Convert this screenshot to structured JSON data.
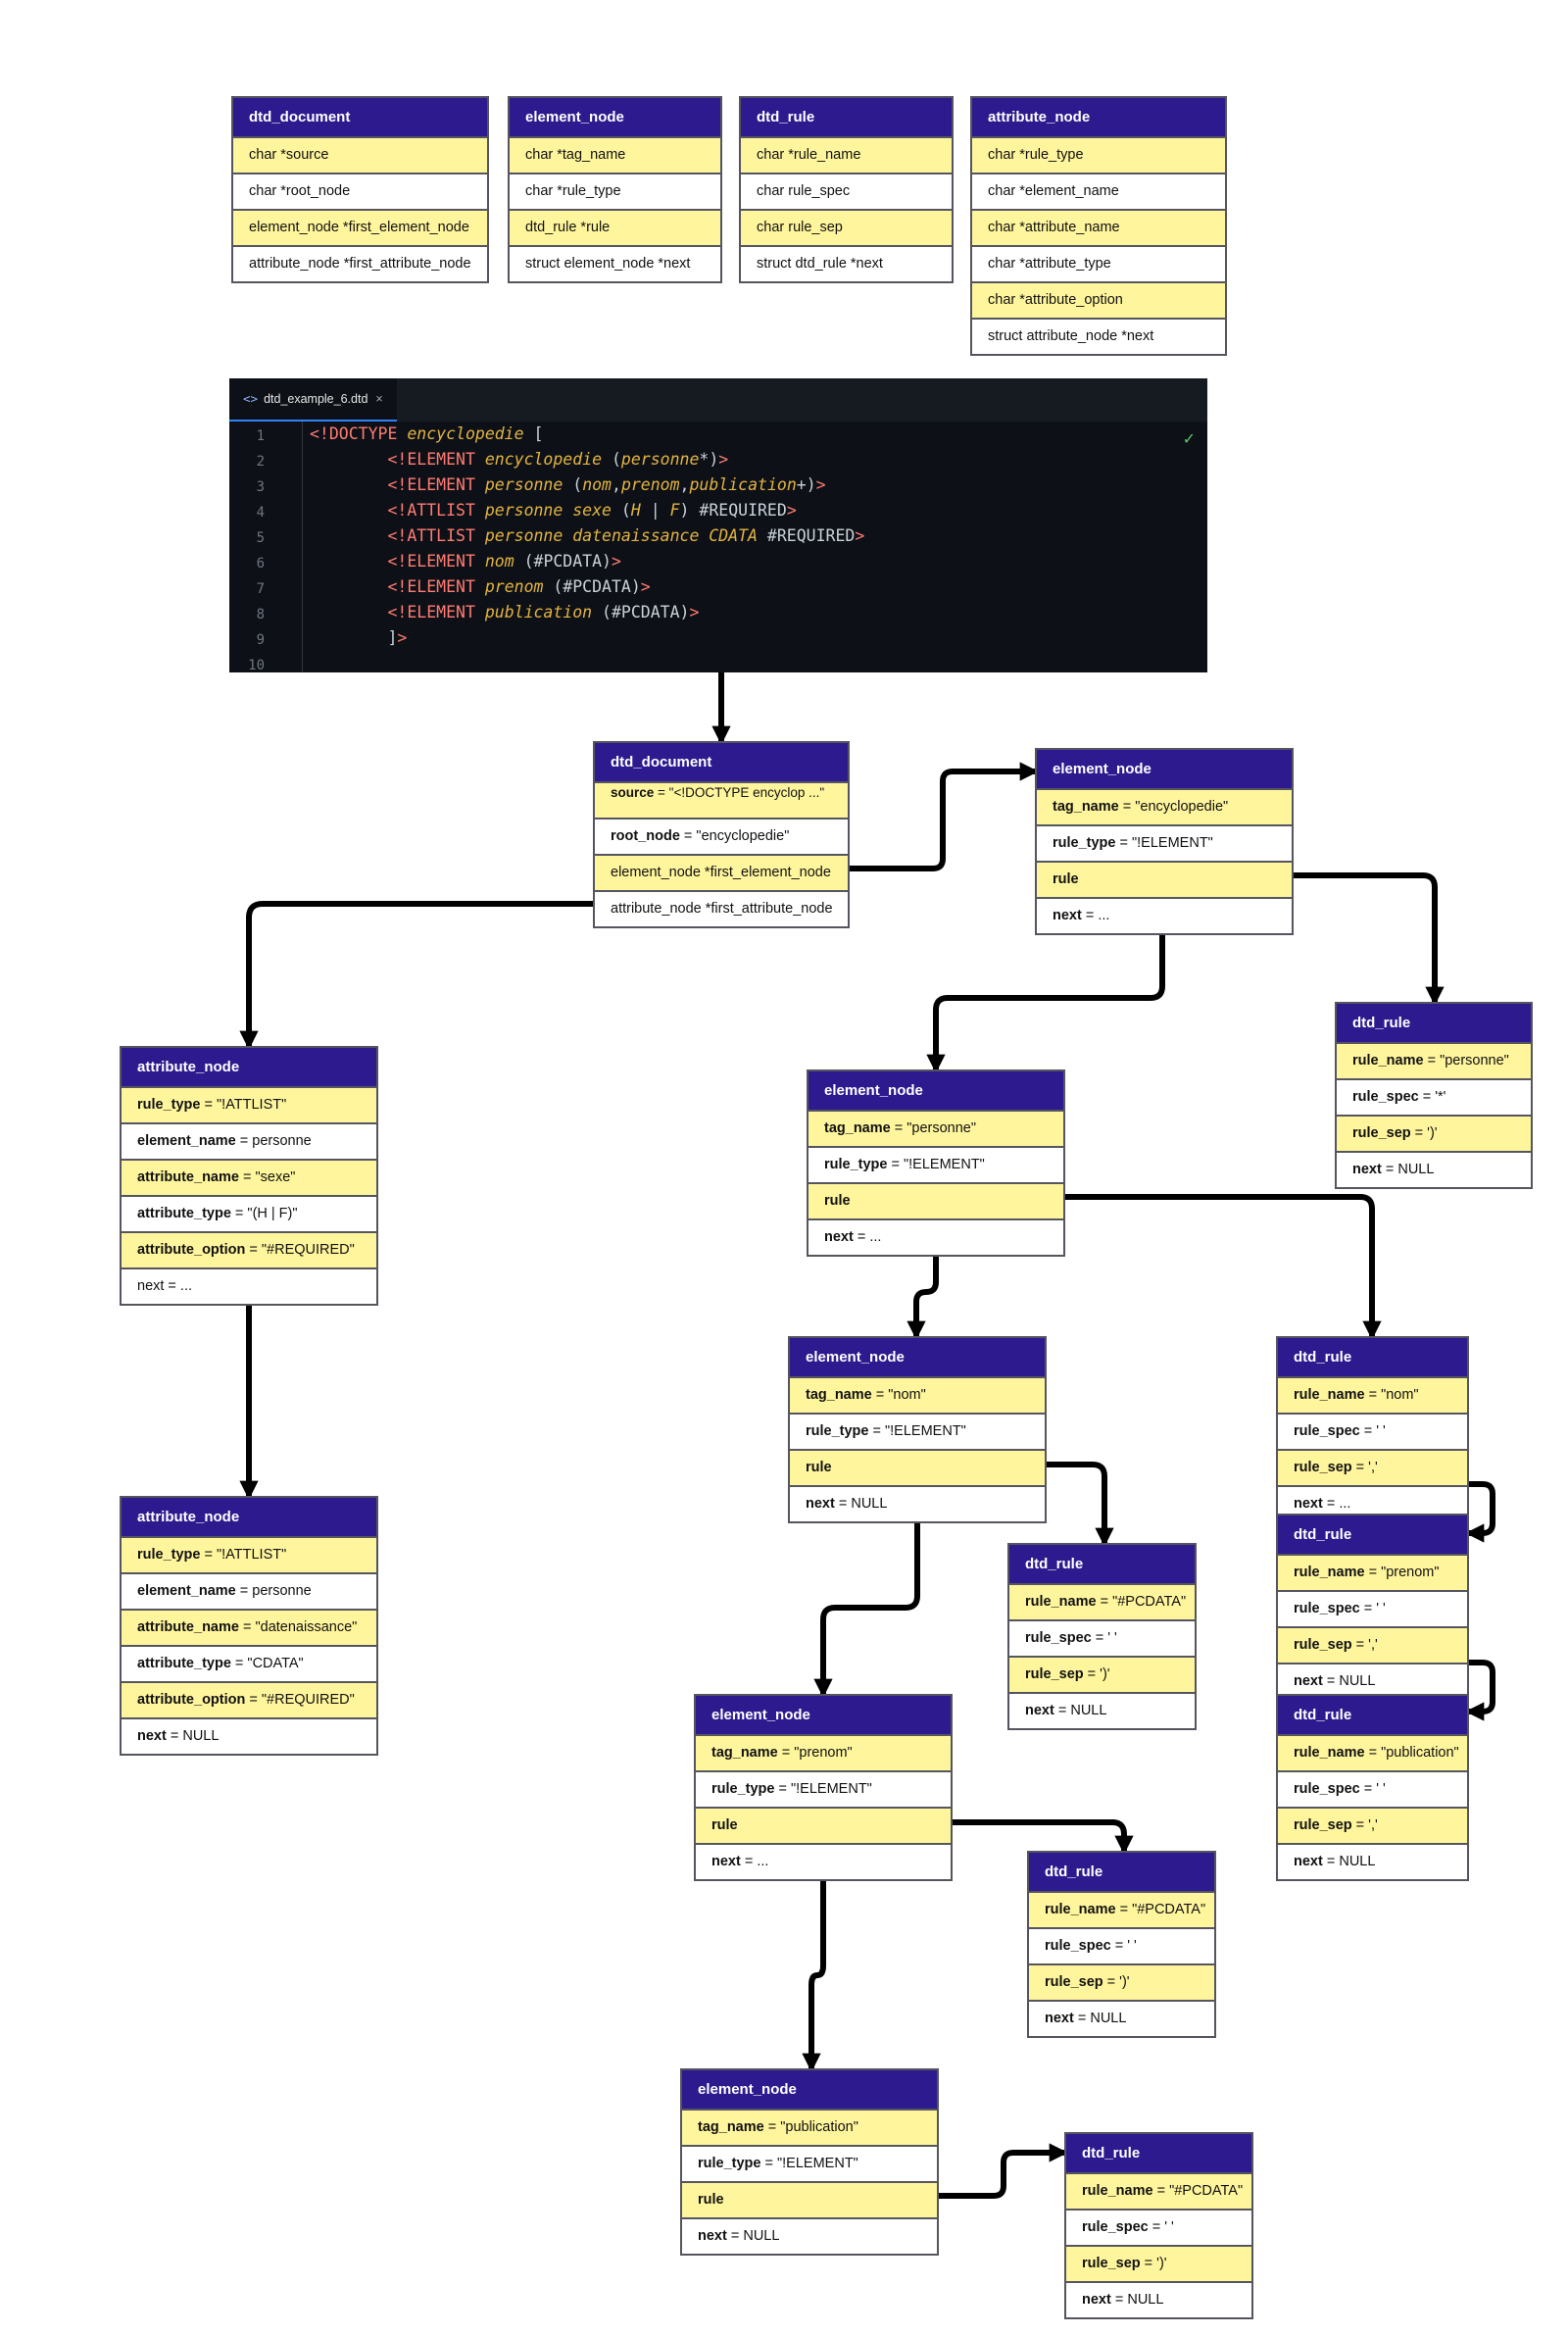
{
  "legend": [
    {
      "title": "dtd_document",
      "rows": [
        "char *source",
        "char *root_node",
        "element_node *first_element_node",
        "attribute_node *first_attribute_node"
      ]
    },
    {
      "title": "element_node",
      "rows": [
        "char *tag_name",
        "char *rule_type",
        "dtd_rule *rule",
        "struct element_node *next"
      ]
    },
    {
      "title": "dtd_rule",
      "rows": [
        "char *rule_name",
        "char rule_spec",
        "char rule_sep",
        "struct dtd_rule *next"
      ]
    },
    {
      "title": "attribute_node",
      "rows": [
        "char *rule_type",
        "char *element_name",
        "char *attribute_name",
        "char *attribute_type",
        "char *attribute_option",
        "struct attribute_node *next"
      ]
    }
  ],
  "editor": {
    "tab_label": "dtd_example_6.dtd",
    "tab_close": "×",
    "tab_icon": "<>",
    "check": "✓",
    "line_numbers": [
      "1",
      "2",
      "3",
      "4",
      "5",
      "6",
      "7",
      "8",
      "9",
      "10"
    ],
    "lines": [
      [
        [
          "kw",
          "<!DOCTYPE "
        ],
        [
          "nm",
          "encyclopedie"
        ],
        [
          "pl",
          " ["
        ]
      ],
      [
        [
          "pl",
          "        "
        ],
        [
          "kw",
          "<!ELEMENT "
        ],
        [
          "nm",
          "encyclopedie"
        ],
        [
          "pl",
          " ("
        ],
        [
          "nm",
          "personne"
        ],
        [
          "pl",
          "*)"
        ],
        [
          "kw",
          ">"
        ]
      ],
      [
        [
          "pl",
          "        "
        ],
        [
          "kw",
          "<!ELEMENT "
        ],
        [
          "nm",
          "personne"
        ],
        [
          "pl",
          " ("
        ],
        [
          "nm",
          "nom"
        ],
        [
          "pl",
          ","
        ],
        [
          "nm",
          "prenom"
        ],
        [
          "pl",
          ","
        ],
        [
          "nm",
          "publication"
        ],
        [
          "pl",
          "+)"
        ],
        [
          "kw",
          ">"
        ]
      ],
      [
        [
          "pl",
          "        "
        ],
        [
          "kw",
          "<!ATTLIST "
        ],
        [
          "nm",
          "personne sexe"
        ],
        [
          "pl",
          " ("
        ],
        [
          "nm",
          "H"
        ],
        [
          "pl",
          " | "
        ],
        [
          "nm",
          "F"
        ],
        [
          "pl",
          ") #REQUIRED"
        ],
        [
          "kw",
          ">"
        ]
      ],
      [
        [
          "pl",
          "        "
        ],
        [
          "kw",
          "<!ATTLIST "
        ],
        [
          "nm",
          "personne datenaissance CDATA"
        ],
        [
          "pl",
          " #REQUIRED"
        ],
        [
          "kw",
          ">"
        ]
      ],
      [
        [
          "pl",
          "        "
        ],
        [
          "kw",
          "<!ELEMENT "
        ],
        [
          "nm",
          "nom"
        ],
        [
          "pl",
          " (#PCDATA)"
        ],
        [
          "kw",
          ">"
        ]
      ],
      [
        [
          "pl",
          "        "
        ],
        [
          "kw",
          "<!ELEMENT "
        ],
        [
          "nm",
          "prenom"
        ],
        [
          "pl",
          " (#PCDATA)"
        ],
        [
          "kw",
          ">"
        ]
      ],
      [
        [
          "pl",
          "        "
        ],
        [
          "kw",
          "<!ELEMENT "
        ],
        [
          "nm",
          "publication"
        ],
        [
          "pl",
          " (#PCDATA)"
        ],
        [
          "kw",
          ">"
        ]
      ],
      [
        [
          "pl",
          "        ]"
        ],
        [
          "kw",
          ">"
        ]
      ],
      [
        [
          "pl",
          ""
        ]
      ]
    ]
  },
  "nodes": {
    "doc": {
      "title": "dtd_document",
      "rows": [
        {
          "k": "source",
          "v": " = \"<!DOCTYPE encyclop ...\""
        },
        {
          "k": "root_node",
          "v": " = \"encyclopedie\""
        },
        {
          "k": "",
          "v": "element_node *first_element_node"
        },
        {
          "k": "",
          "v": "attribute_node *first_attribute_node"
        }
      ]
    },
    "el_ency": {
      "title": "element_node",
      "rows": [
        {
          "k": "tag_name",
          "v": " = \"encyclopedie\""
        },
        {
          "k": "rule_type",
          "v": " = \"!ELEMENT\""
        },
        {
          "k": "rule",
          "v": ""
        },
        {
          "k": "next",
          "v": " = ..."
        }
      ]
    },
    "rule_pers": {
      "title": "dtd_rule",
      "rows": [
        {
          "k": "rule_name",
          "v": " = \"personne\""
        },
        {
          "k": "rule_spec",
          "v": " = '*'"
        },
        {
          "k": "rule_sep",
          "v": " = ')'"
        },
        {
          "k": "next",
          "v": " =  NULL"
        }
      ]
    },
    "el_pers": {
      "title": "element_node",
      "rows": [
        {
          "k": "tag_name",
          "v": " = \"personne\""
        },
        {
          "k": "rule_type",
          "v": " = \"!ELEMENT\""
        },
        {
          "k": "rule",
          "v": ""
        },
        {
          "k": "next",
          "v": " = ..."
        }
      ]
    },
    "attr_sexe": {
      "title": "attribute_node",
      "rows": [
        {
          "k": "rule_type",
          "v": " = \"!ATTLIST\""
        },
        {
          "k": "element_name",
          "v": " = personne"
        },
        {
          "k": "attribute_name",
          "v": " = \"sexe\""
        },
        {
          "k": "attribute_type",
          "v": " = \"(H | F)\""
        },
        {
          "k": "attribute_option",
          "v": " = \"#REQUIRED\""
        },
        {
          "k": "",
          "v": "next = ..."
        }
      ]
    },
    "attr_date": {
      "title": "attribute_node",
      "rows": [
        {
          "k": "rule_type",
          "v": " = \"!ATTLIST\""
        },
        {
          "k": "element_name",
          "v": " = personne"
        },
        {
          "k": "attribute_name",
          "v": " = \"datenaissance\""
        },
        {
          "k": "attribute_type",
          "v": " = \"CDATA\""
        },
        {
          "k": "attribute_option",
          "v": " = \"#REQUIRED\""
        },
        {
          "k": "next",
          "v": " = NULL"
        }
      ]
    },
    "el_nom": {
      "title": "element_node",
      "rows": [
        {
          "k": "tag_name",
          "v": " = \"nom\""
        },
        {
          "k": "rule_type",
          "v": " = \"!ELEMENT\""
        },
        {
          "k": "rule",
          "v": ""
        },
        {
          "k": "next",
          "v": " = NULL"
        }
      ]
    },
    "rule_nom_pc": {
      "title": "dtd_rule",
      "rows": [
        {
          "k": "rule_name",
          "v": " = \"#PCDATA\""
        },
        {
          "k": "rule_spec",
          "v": " = ' '"
        },
        {
          "k": "rule_sep",
          "v": " = ')'"
        },
        {
          "k": "next",
          "v": " =  NULL"
        }
      ]
    },
    "rule_nom": {
      "title": "dtd_rule",
      "rows": [
        {
          "k": "rule_name",
          "v": " = \"nom\""
        },
        {
          "k": "rule_spec",
          "v": " = ' '"
        },
        {
          "k": "rule_sep",
          "v": " = ','"
        },
        {
          "k": "next",
          "v": " =  ..."
        }
      ]
    },
    "rule_prenom": {
      "title": "dtd_rule",
      "rows": [
        {
          "k": "rule_name",
          "v": " = \"prenom\""
        },
        {
          "k": "rule_spec",
          "v": " = ' '"
        },
        {
          "k": "rule_sep",
          "v": " = ','"
        },
        {
          "k": "next",
          "v": " =  NULL"
        }
      ]
    },
    "rule_pub": {
      "title": "dtd_rule",
      "rows": [
        {
          "k": "rule_name",
          "v": " = \"publication\""
        },
        {
          "k": "rule_spec",
          "v": " = ' '"
        },
        {
          "k": "rule_sep",
          "v": " = ','"
        },
        {
          "k": "next",
          "v": " =  NULL"
        }
      ]
    },
    "el_prenom": {
      "title": "element_node",
      "rows": [
        {
          "k": "tag_name",
          "v": " = \"prenom\""
        },
        {
          "k": "rule_type",
          "v": " = \"!ELEMENT\""
        },
        {
          "k": "rule",
          "v": ""
        },
        {
          "k": "next",
          "v": " = ..."
        }
      ]
    },
    "rule_prenom_pc": {
      "title": "dtd_rule",
      "rows": [
        {
          "k": "rule_name",
          "v": " = \"#PCDATA\""
        },
        {
          "k": "rule_spec",
          "v": " = ' '"
        },
        {
          "k": "rule_sep",
          "v": " = ')'"
        },
        {
          "k": "next",
          "v": " =  NULL"
        }
      ]
    },
    "el_pub": {
      "title": "element_node",
      "rows": [
        {
          "k": "tag_name",
          "v": " = \"publication\""
        },
        {
          "k": "rule_type",
          "v": " = \"!ELEMENT\""
        },
        {
          "k": "rule",
          "v": ""
        },
        {
          "k": "next",
          "v": " = NULL"
        }
      ]
    },
    "rule_pub_pc": {
      "title": "dtd_rule",
      "rows": [
        {
          "k": "rule_name",
          "v": " = \"#PCDATA\""
        },
        {
          "k": "rule_spec",
          "v": " = ' '"
        },
        {
          "k": "rule_sep",
          "v": " = ')'"
        },
        {
          "k": "next",
          "v": " =  NULL"
        }
      ]
    }
  }
}
